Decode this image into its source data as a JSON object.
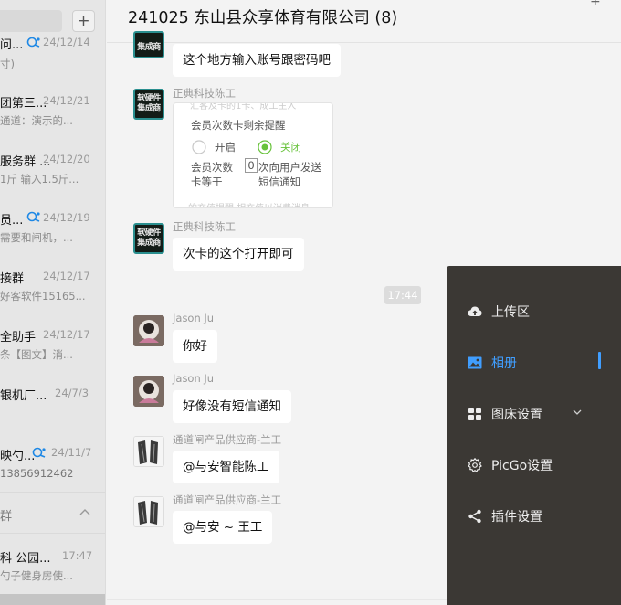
{
  "sidebar": {
    "add_label": "+",
    "conversations": [
      {
        "title": "问...",
        "date": "24/12/14",
        "preview": "寸)",
        "mention": true
      },
      {
        "title": "团第三...",
        "date": "24/12/21",
        "preview": "通道：演示的...",
        "mention": false
      },
      {
        "title": "服务群 ...",
        "date": "24/12/20",
        "preview": "1斤  输入1.5斤...",
        "mention": false
      },
      {
        "title": "员...",
        "date": "24/12/19",
        "preview": "需要和闸机，...",
        "mention": true
      },
      {
        "title": "接群",
        "date": "24/12/17",
        "preview": "好客软件15165...",
        "mention": false
      },
      {
        "title": "全助手",
        "date": "24/12/17",
        "preview": "条【图文】消...",
        "mention": false
      },
      {
        "title": "银机厂...",
        "date": "24/7/3",
        "preview": "",
        "mention": false
      },
      {
        "title": "映勺...",
        "date": "24/11/7",
        "preview": "13856912462",
        "mention": true
      }
    ],
    "group_label": "群",
    "bottom_conv": {
      "title": "科 公园...",
      "date": "17:47",
      "preview": "勺子健身房使..."
    }
  },
  "chat": {
    "title": "241025  东山县众享体育有限公司 (8)",
    "more": "+",
    "time_divider": "17:44",
    "messages": [
      {
        "sender": "",
        "text": "这个地方输入账号跟密码吧",
        "avatar": "company"
      },
      {
        "sender": "正典科技陈工",
        "image": {
          "top_cut": "汇客及卡的1卡、成工主人",
          "heading": "会员次数卡剩余提醒",
          "option_on": "开启",
          "option_off": "关闭",
          "line1_a": "会员次数",
          "line1_box": "0",
          "line1_b": "次向用户发送",
          "line2_a": "卡等于",
          "line2_b": "短信通知",
          "bottom_cut": "的充值提醒  相充值以消费消息"
        },
        "avatar": "company"
      },
      {
        "sender": "正典科技陈工",
        "text": "次卡的这个打开即可",
        "avatar": "company"
      },
      {
        "sender": "Jason Ju",
        "text": "你好",
        "avatar": "person"
      },
      {
        "sender": "Jason Ju",
        "text": "好像没有短信通知",
        "avatar": "person"
      },
      {
        "sender": "通道闸产品供应商-兰工",
        "text": "@与安智能陈工",
        "avatar": "gate"
      },
      {
        "sender": "通道闸产品供应商-兰工",
        "text": "@与安 ~ 王工",
        "avatar": "gate"
      }
    ],
    "company_avatar_text": [
      "软硬件",
      "集成商"
    ]
  },
  "picgo_menu": {
    "items": [
      {
        "label": "上传区",
        "icon": "cloud-upload-icon"
      },
      {
        "label": "相册",
        "icon": "image-icon",
        "active": true
      },
      {
        "label": "图床设置",
        "icon": "grid-icon",
        "has_submenu": true
      },
      {
        "label": "PicGo设置",
        "icon": "gear-icon"
      },
      {
        "label": "插件设置",
        "icon": "share-icon"
      }
    ],
    "bg_color": "#3b3834",
    "accent_color": "#409eff"
  }
}
